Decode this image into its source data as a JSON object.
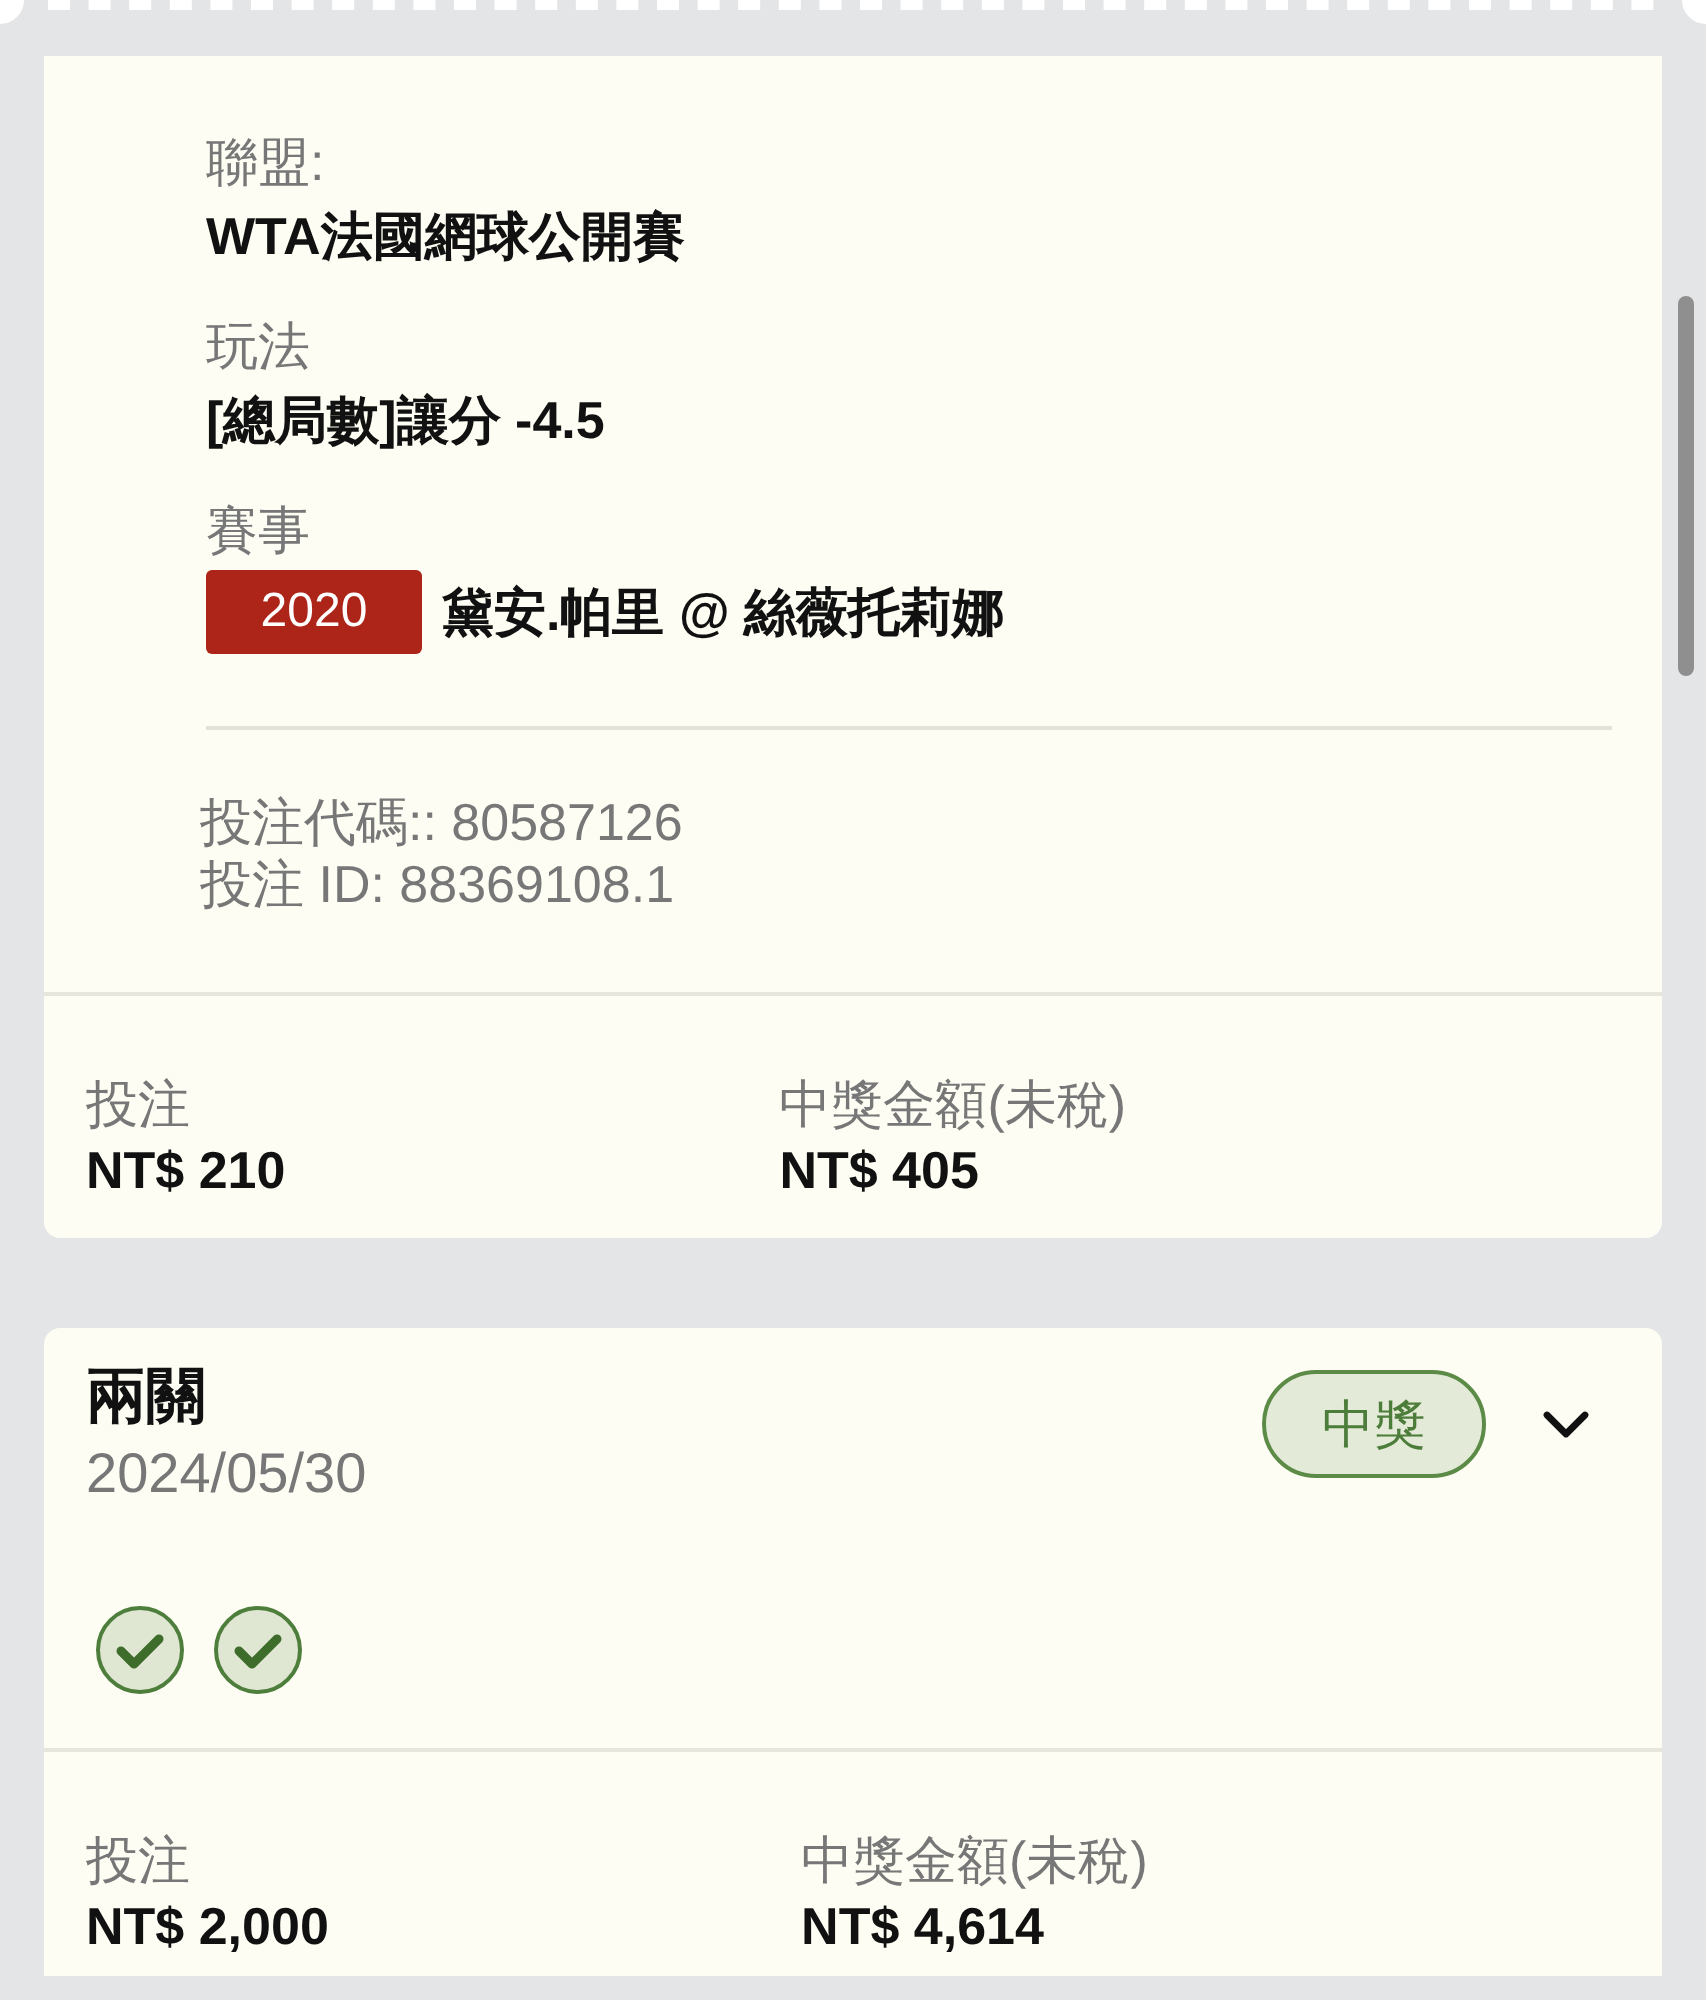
{
  "bets": [
    {
      "kind": "single",
      "details": [
        {
          "label": "聯盟:",
          "value": "WTA法國網球公開賽"
        },
        {
          "label": "玩法",
          "value": "[總局數]讓分 -4.5"
        },
        {
          "label": "賽事",
          "code": "2020",
          "value": "黛安.帕里 @ 絲薇托莉娜"
        }
      ],
      "references": [
        "投注代碼:: 80587126",
        "投注 ID: 88369108.1"
      ],
      "stake": {
        "label": "投注",
        "value": "NT$ 210"
      },
      "payout": {
        "label": "中獎金額(未稅)",
        "value": "NT$ 405"
      }
    },
    {
      "kind": "parlay",
      "title": "兩關",
      "date": "2024/05/30",
      "status": {
        "label": "中獎",
        "kind": "won"
      },
      "expanded": false,
      "legs": [
        {
          "won": true
        },
        {
          "won": true
        }
      ],
      "stake": {
        "label": "投注",
        "value": "NT$ 2,000"
      },
      "payout": {
        "label": "中獎金額(未稅)",
        "value": "NT$ 4,614"
      }
    }
  ]
}
